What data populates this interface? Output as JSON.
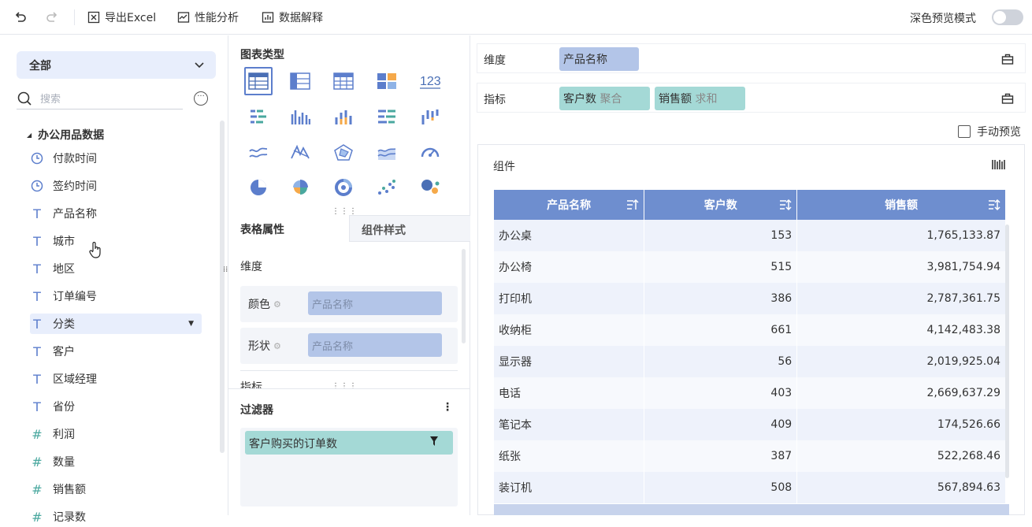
{
  "toolbar": {
    "undo": "undo-icon",
    "redo": "redo-icon",
    "export_label": "导出Excel",
    "perf_label": "性能分析",
    "explain_label": "数据解释",
    "dark_mode_label": "深色预览模式"
  },
  "left": {
    "scope_label": "全部",
    "search_placeholder": "搜索",
    "dataset_title": "办公用品数据",
    "fields": [
      {
        "label": "付款时间",
        "type": "time"
      },
      {
        "label": "签约时间",
        "type": "time"
      },
      {
        "label": "产品名称",
        "type": "text"
      },
      {
        "label": "城市",
        "type": "text"
      },
      {
        "label": "地区",
        "type": "text"
      },
      {
        "label": "订单编号",
        "type": "text"
      },
      {
        "label": "分类",
        "type": "text"
      },
      {
        "label": "客户",
        "type": "text"
      },
      {
        "label": "区域经理",
        "type": "text"
      },
      {
        "label": "省份",
        "type": "text"
      },
      {
        "label": "利润",
        "type": "number"
      },
      {
        "label": "数量",
        "type": "number"
      },
      {
        "label": "销售额",
        "type": "number"
      },
      {
        "label": "记录数",
        "type": "number"
      }
    ]
  },
  "middle": {
    "chart_type_title": "图表类型",
    "tab_table_props": "表格属性",
    "tab_component_style": "组件样式",
    "dimension_label": "维度",
    "color_label": "颜色",
    "color_value": "产品名称",
    "shape_label": "形状",
    "shape_value": "产品名称",
    "indicator_label_cut": "指标",
    "filter_title": "过滤器",
    "filter_chip": "客户购买的订单数"
  },
  "right": {
    "dimension_label": "维度",
    "dimension_chip": "产品名称",
    "indicator_label": "指标",
    "indicator_chip1_name": "客户数",
    "indicator_chip1_agg": "聚合",
    "indicator_chip2_name": "销售额",
    "indicator_chip2_agg": "求和",
    "manual_preview": "手动预览",
    "component_title": "组件",
    "table": {
      "headers": [
        "产品名称",
        "客户数",
        "销售额"
      ],
      "rows": [
        [
          "办公桌",
          "153",
          "1,765,133.87"
        ],
        [
          "办公椅",
          "515",
          "3,981,754.94"
        ],
        [
          "打印机",
          "386",
          "2,787,361.75"
        ],
        [
          "收纳柜",
          "661",
          "4,142,483.38"
        ],
        [
          "显示器",
          "56",
          "2,019,925.04"
        ],
        [
          "电话",
          "403",
          "2,669,637.29"
        ],
        [
          "笔记本",
          "409",
          "174,526.66"
        ],
        [
          "纸张",
          "387",
          "522,268.46"
        ],
        [
          "装订机",
          "508",
          "567,894.63"
        ]
      ]
    }
  },
  "colors": {
    "accent": "#5c7ecc",
    "header_bg": "#6e8ecf",
    "dim_chip": "#b3c5e8",
    "measure_chip": "#a4d9d6"
  }
}
